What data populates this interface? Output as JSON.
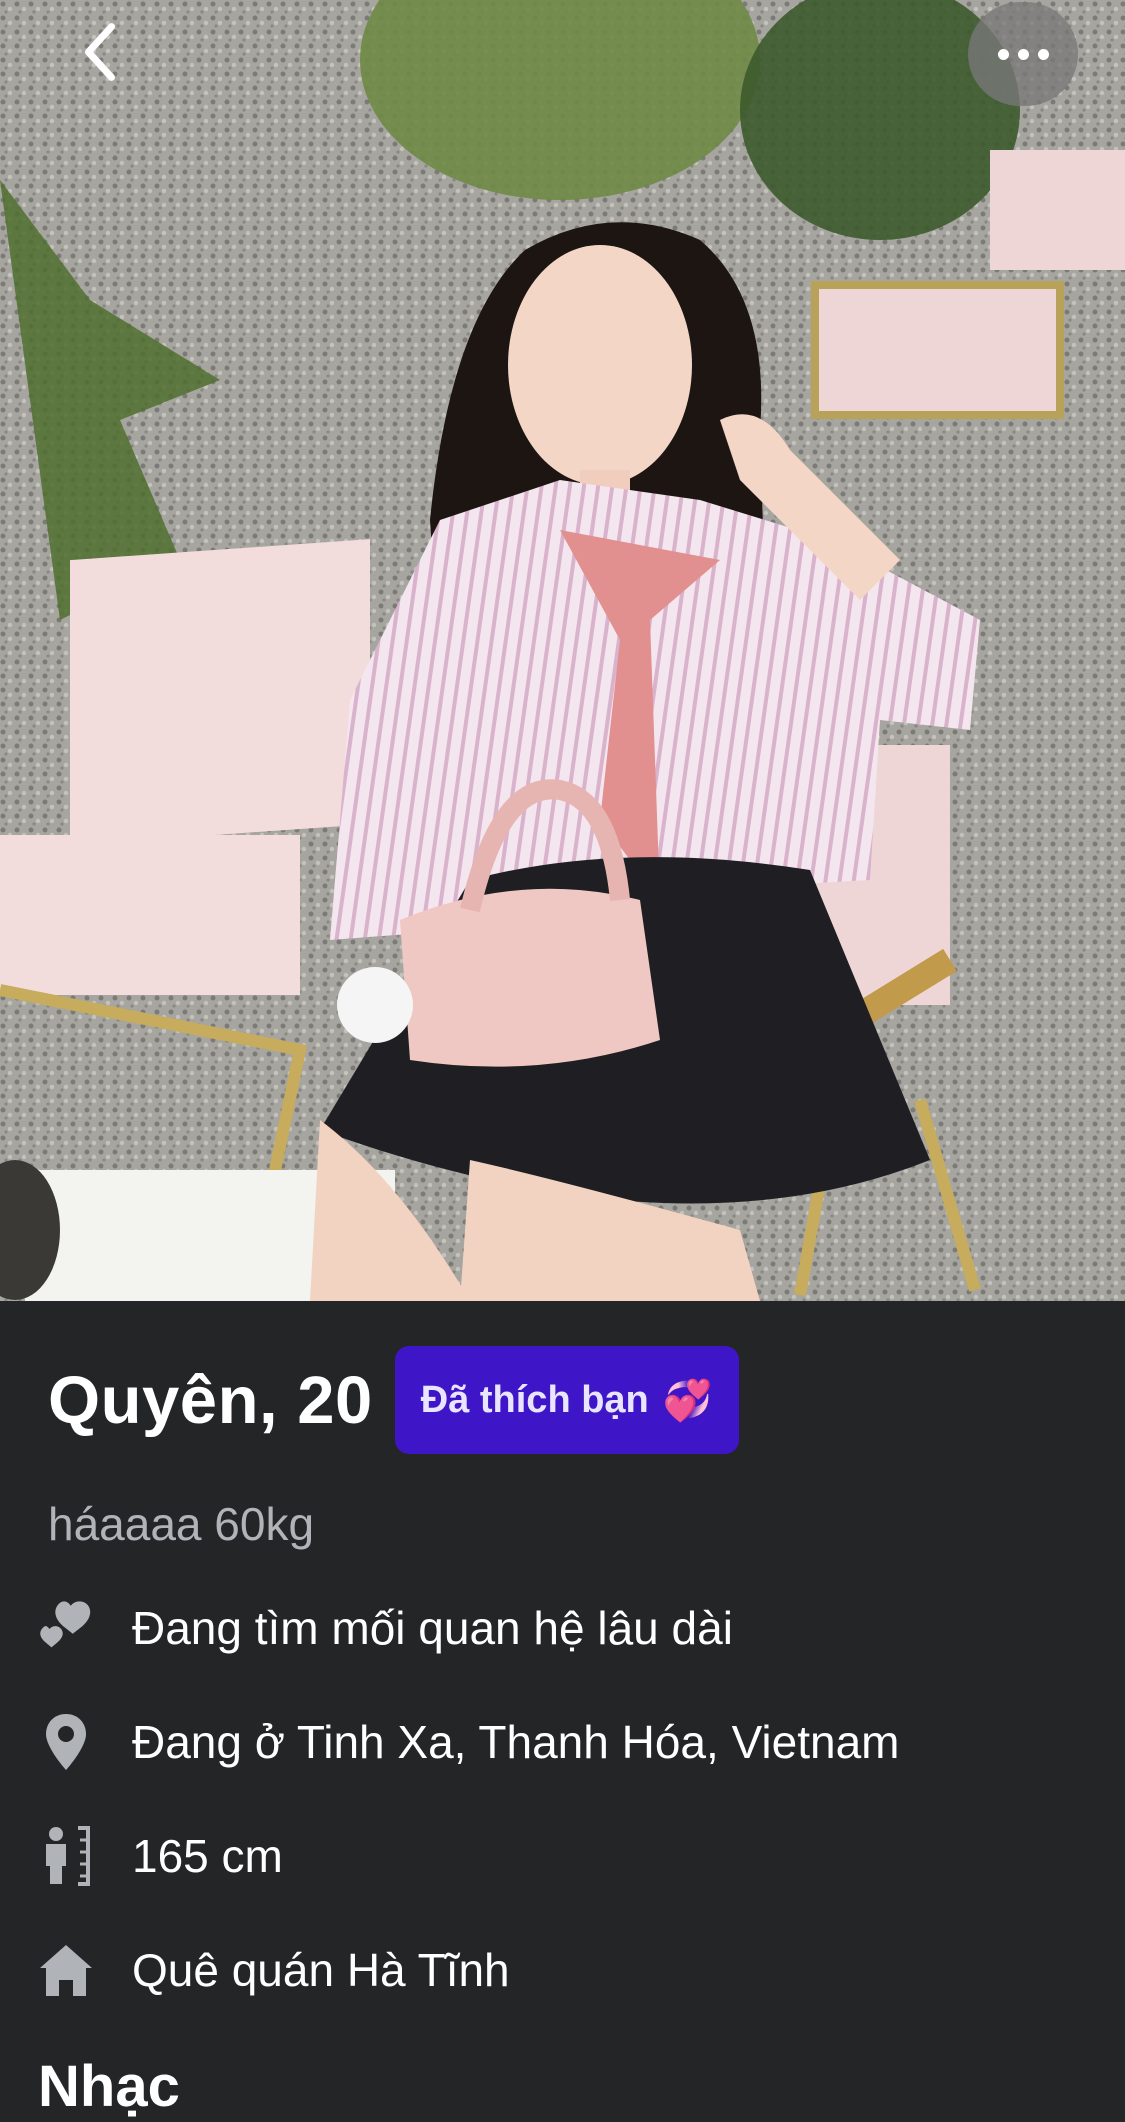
{
  "profile": {
    "name_age": "Quyên, 20",
    "liked_badge": "Đã thích bạn",
    "liked_badge_emoji": "💞",
    "bio": "háaaaa 60kg",
    "details": [
      {
        "icon": "hearts-icon",
        "text": "Đang tìm mối quan hệ lâu dài"
      },
      {
        "icon": "location-pin-icon",
        "text": "Đang ở Tinh Xa, Thanh Hóa, Vietnam"
      },
      {
        "icon": "height-icon",
        "text": "165 cm"
      },
      {
        "icon": "home-icon",
        "text": "Quê quán Hà Tĩnh"
      }
    ],
    "music_section_title": "Nhạc"
  },
  "colors": {
    "background": "#242526",
    "badge": "#3f16c7",
    "secondary_text": "#b0b3b8",
    "icon": "#b0b3b8"
  }
}
